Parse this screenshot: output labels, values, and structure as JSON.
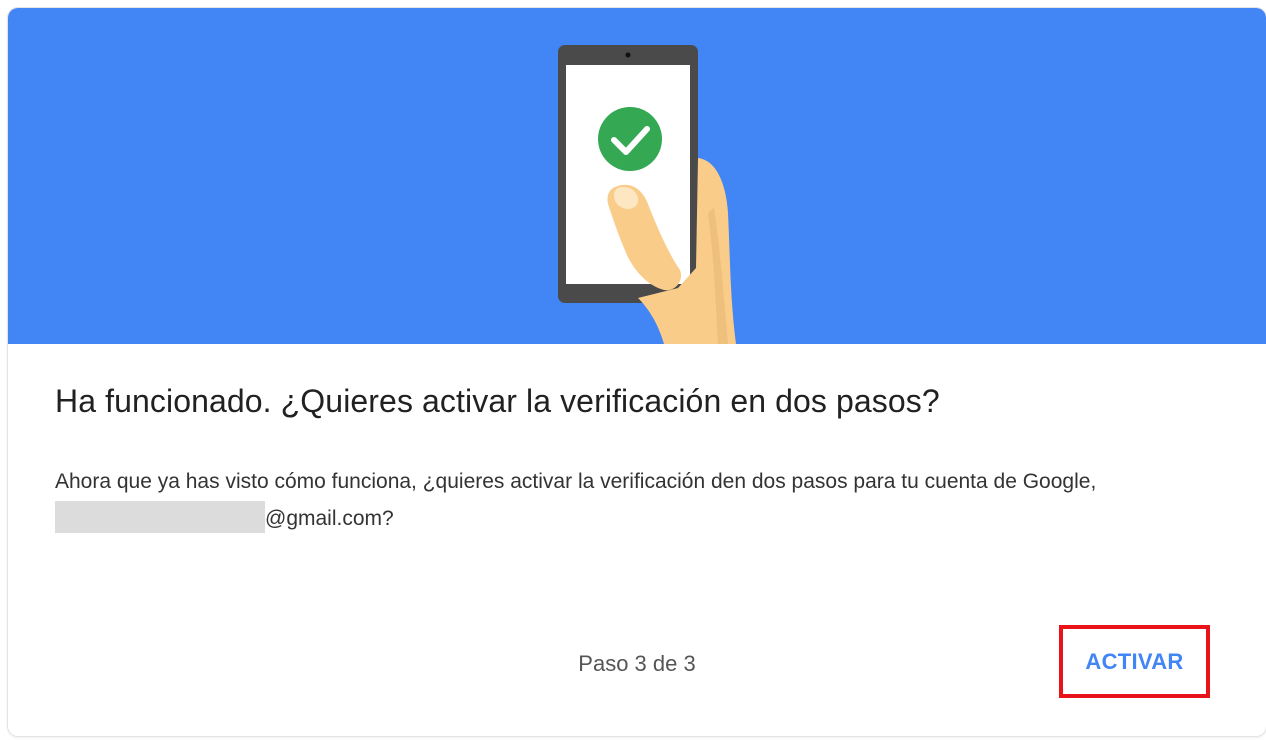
{
  "dialog": {
    "title": "Ha funcionado. ¿Quieres activar la verificación en dos pasos?",
    "description_part1": "Ahora que ya has visto cómo funciona, ¿quieres activar la verificación den dos pasos para tu cuenta de Google,",
    "email_suffix": "@gmail.com?",
    "step_indicator": "Paso 3 de 3",
    "activate_label": "ACTIVAR"
  },
  "illustration": {
    "icon": "phone-with-check-icon"
  },
  "colors": {
    "hero_background": "#4285f4",
    "check_green": "#34a853",
    "accent_blue": "#4285f4",
    "highlight_red": "#e8141a"
  }
}
